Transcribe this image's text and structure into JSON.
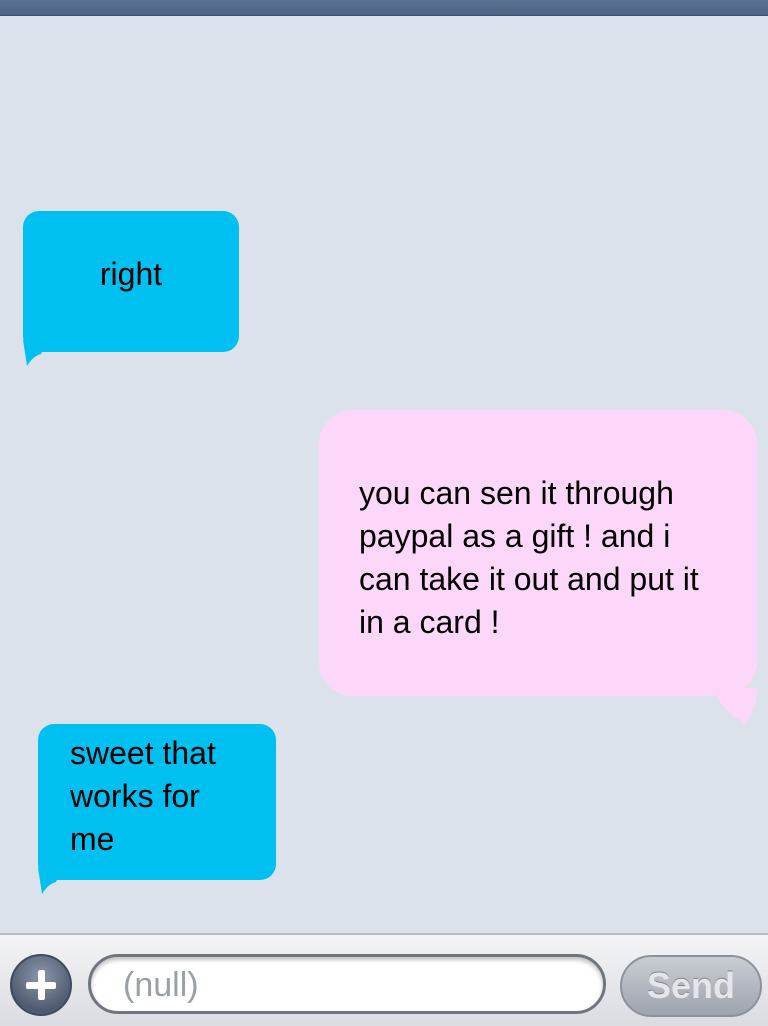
{
  "thread": {
    "messages": [
      {
        "direction": "incoming",
        "text": "right"
      },
      {
        "direction": "outgoing",
        "text": "you can sen it through paypal as a gift ! and i can take it out and put it in a card !"
      },
      {
        "direction": "incoming",
        "text": "sweet that works for me"
      }
    ]
  },
  "composer": {
    "placeholder": "(null)",
    "send_label": "Send"
  },
  "colors": {
    "incoming_bubble": "#00c0f2",
    "outgoing_bubble": "#fdd7fa",
    "background": "#dce2ec"
  }
}
